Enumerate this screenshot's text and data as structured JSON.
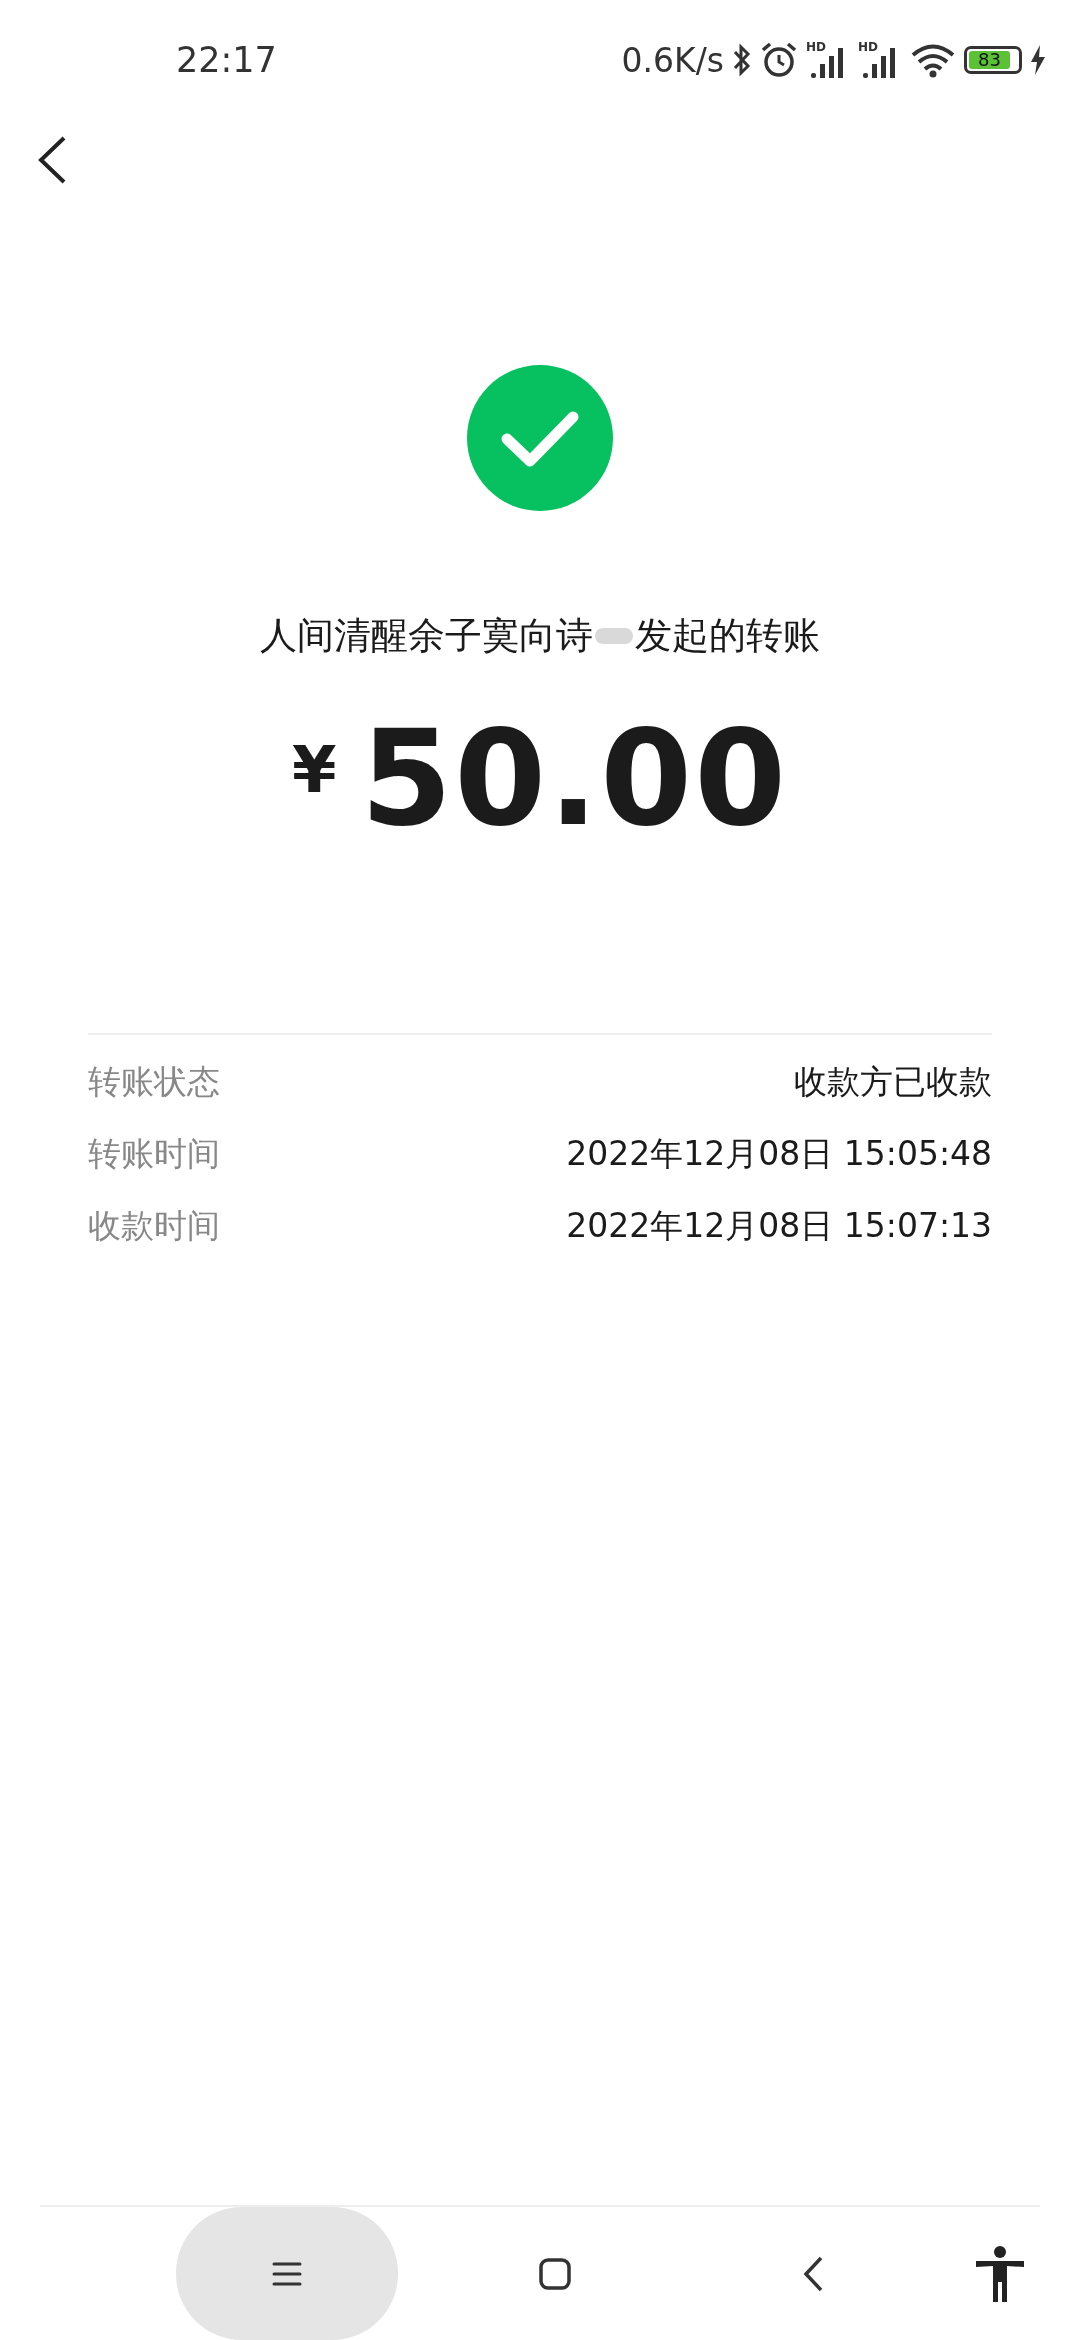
{
  "status_bar": {
    "time": "22:17",
    "speed": "0.6K/s",
    "signal_labels": [
      "HD",
      "HD"
    ],
    "battery": "83"
  },
  "transfer": {
    "payer_text": "人间清醒余子寞向诗",
    "suffix_text": "发起的转账",
    "currency": "¥",
    "amount": "50.00"
  },
  "details": [
    {
      "label": "转账状态",
      "value": "收款方已收款"
    },
    {
      "label": "转账时间",
      "value": "2022年12月08日 15:05:48"
    },
    {
      "label": "收款时间",
      "value": "2022年12月08日 15:07:13"
    }
  ]
}
